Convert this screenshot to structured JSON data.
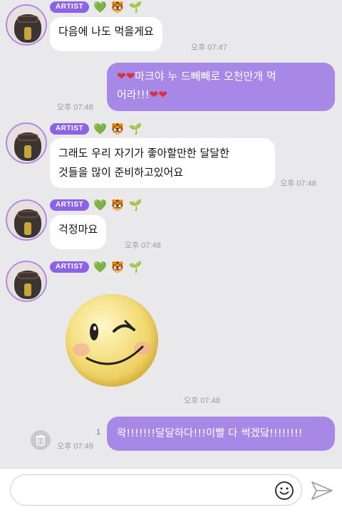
{
  "messages": [
    {
      "badge": "ARTIST",
      "text": "다음에 나도 먹을게요",
      "time": "오후 07:47"
    },
    {
      "text_1": "마크야 누 드빼빼로 오천만개 먹",
      "text_2": "어라!!!",
      "time": "오후 07:48"
    },
    {
      "badge": "ARTIST",
      "text_1": "그래도 우리 자기가 좋아할만한 달달한",
      "text_2": "것들을 많이 준비하고있어요",
      "time": "오후 07:48"
    },
    {
      "badge": "ARTIST",
      "text": "걱정마요",
      "time": "오후 07:48"
    },
    {
      "badge": "ARTIST",
      "time": "오후 07:48"
    },
    {
      "text": "왁!!!!!!!달달하다!!!이빨 다 썩겠닼!!!!!!!!",
      "time": "오후 07:49",
      "unread": "1"
    }
  ],
  "input": {
    "placeholder": "",
    "value": ""
  },
  "colors": {
    "accent": "#8c63e6",
    "mine_bubble": "#a888e6",
    "background": "#e9e9ec"
  },
  "icons": {
    "reaction_1": "💚",
    "reaction_2": "🐯",
    "reaction_3": "🌱",
    "heart": "❤"
  }
}
